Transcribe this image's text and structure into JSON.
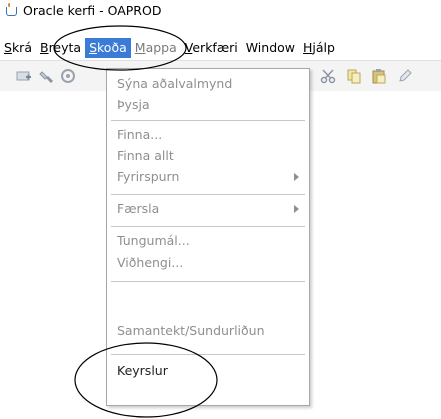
{
  "window": {
    "title": "Oracle kerfi - OAPROD"
  },
  "menubar": {
    "items": [
      {
        "label": "Skrá",
        "state": "normal"
      },
      {
        "label": "Breyta",
        "state": "normal"
      },
      {
        "label": "Skoða",
        "state": "active"
      },
      {
        "label": "Mappa",
        "state": "dim"
      },
      {
        "label": "Verkfæri",
        "state": "normal"
      },
      {
        "label": "Window",
        "state": "normal"
      },
      {
        "label": "Hjálp",
        "state": "normal"
      }
    ]
  },
  "toolbar": {
    "icons": [
      "new-record-icon",
      "flashlight-icon",
      "navigate-icon",
      "cut-icon",
      "copy-icon",
      "paste-icon",
      "edit-icon"
    ]
  },
  "view_menu": {
    "items": [
      {
        "label": "Sýna aðalvalmynd",
        "enabled": false,
        "submenu": false
      },
      {
        "label": "Þysja",
        "enabled": false,
        "submenu": false
      },
      {
        "label": "Finna...",
        "enabled": false,
        "submenu": false
      },
      {
        "label": "Finna allt",
        "enabled": false,
        "submenu": false
      },
      {
        "label": "Fyrirspurn",
        "enabled": false,
        "submenu": true
      },
      {
        "label": "Færsla",
        "enabled": false,
        "submenu": true
      },
      {
        "label": "Tungumál...",
        "enabled": false,
        "submenu": false
      },
      {
        "label": "Viðhengi...",
        "enabled": false,
        "submenu": false
      },
      {
        "label": "Samantekt/Sundurliðun",
        "enabled": false,
        "submenu": false
      },
      {
        "label": "Keyrslur",
        "enabled": true,
        "submenu": false
      }
    ]
  },
  "colors": {
    "highlight": "#3a7bd5",
    "disabled_text": "#8f8f8f",
    "annotation": "#000000"
  }
}
